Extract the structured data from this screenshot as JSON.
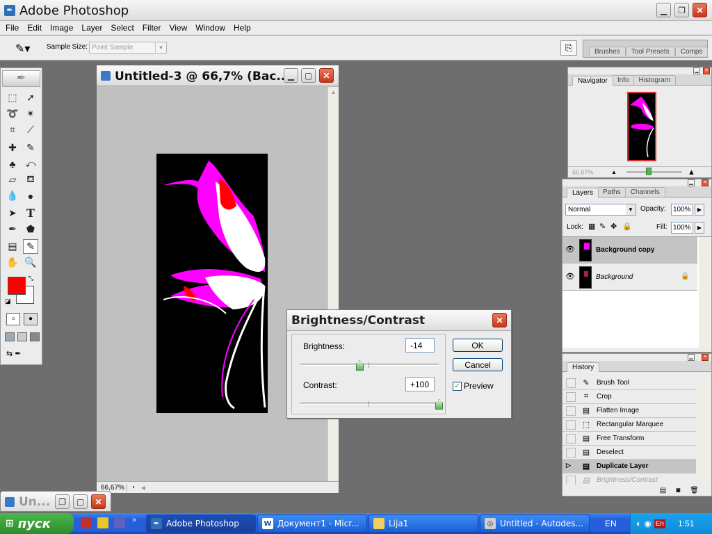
{
  "app": {
    "title": "Adobe Photoshop"
  },
  "menu": [
    "File",
    "Edit",
    "Image",
    "Layer",
    "Select",
    "Filter",
    "View",
    "Window",
    "Help"
  ],
  "options_bar": {
    "sample_size_label": "Sample Size:",
    "sample_size_value": "Point Sample"
  },
  "palette_well": [
    "Brushes",
    "Tool Presets",
    "Comps"
  ],
  "doc_window": {
    "title": "Untitled-3 @ 66,7% (Bac...",
    "zoom": "66,67%"
  },
  "minimized_doc": {
    "title": "Un..."
  },
  "navigator": {
    "tabs": [
      "Navigator",
      "Info",
      "Histogram"
    ],
    "zoom": "66.67%"
  },
  "layers": {
    "tabs": [
      "Layers",
      "Paths",
      "Channels"
    ],
    "blend_mode": "Normal",
    "opacity_label": "Opacity:",
    "opacity": "100%",
    "lock_label": "Lock:",
    "fill_label": "Fill:",
    "fill": "100%",
    "items": [
      {
        "name": "Background copy",
        "selected": true
      },
      {
        "name": "Background",
        "selected": false
      }
    ]
  },
  "history": {
    "tab": "History",
    "items": [
      {
        "label": "Brush Tool",
        "icon": "brush-icon"
      },
      {
        "label": "Crop",
        "icon": "crop-icon"
      },
      {
        "label": "Flatten Image",
        "icon": "document-icon"
      },
      {
        "label": "Rectangular Marquee",
        "icon": "marquee-icon"
      },
      {
        "label": "Free Transform",
        "icon": "document-icon"
      },
      {
        "label": "Deselect",
        "icon": "document-icon"
      },
      {
        "label": "Duplicate Layer",
        "icon": "document-icon",
        "current": true
      },
      {
        "label": "Brightness/Contrast",
        "icon": "document-icon",
        "greyed": true
      }
    ]
  },
  "dialog": {
    "title": "Brightness/Contrast",
    "brightness_label": "Brightness:",
    "brightness_value": "-14",
    "contrast_label": "Contrast:",
    "contrast_value": "+100",
    "ok_label": "OK",
    "cancel_label": "Cancel",
    "preview_label": "Preview",
    "preview_checked": true,
    "brightness_fraction": 0.43,
    "contrast_fraction": 1.0
  },
  "colors": {
    "foreground": "#ff0000",
    "background": "#ffffff",
    "magenta": "#ff00ff"
  },
  "taskbar": {
    "start_label": "пуск",
    "tasks": [
      "Adobe Photoshop",
      "Документ1 - Micr...",
      "Lija1",
      "Untitled - Autodes..."
    ],
    "lang": "EN",
    "tray_lang": "En",
    "clock": "1:51"
  }
}
